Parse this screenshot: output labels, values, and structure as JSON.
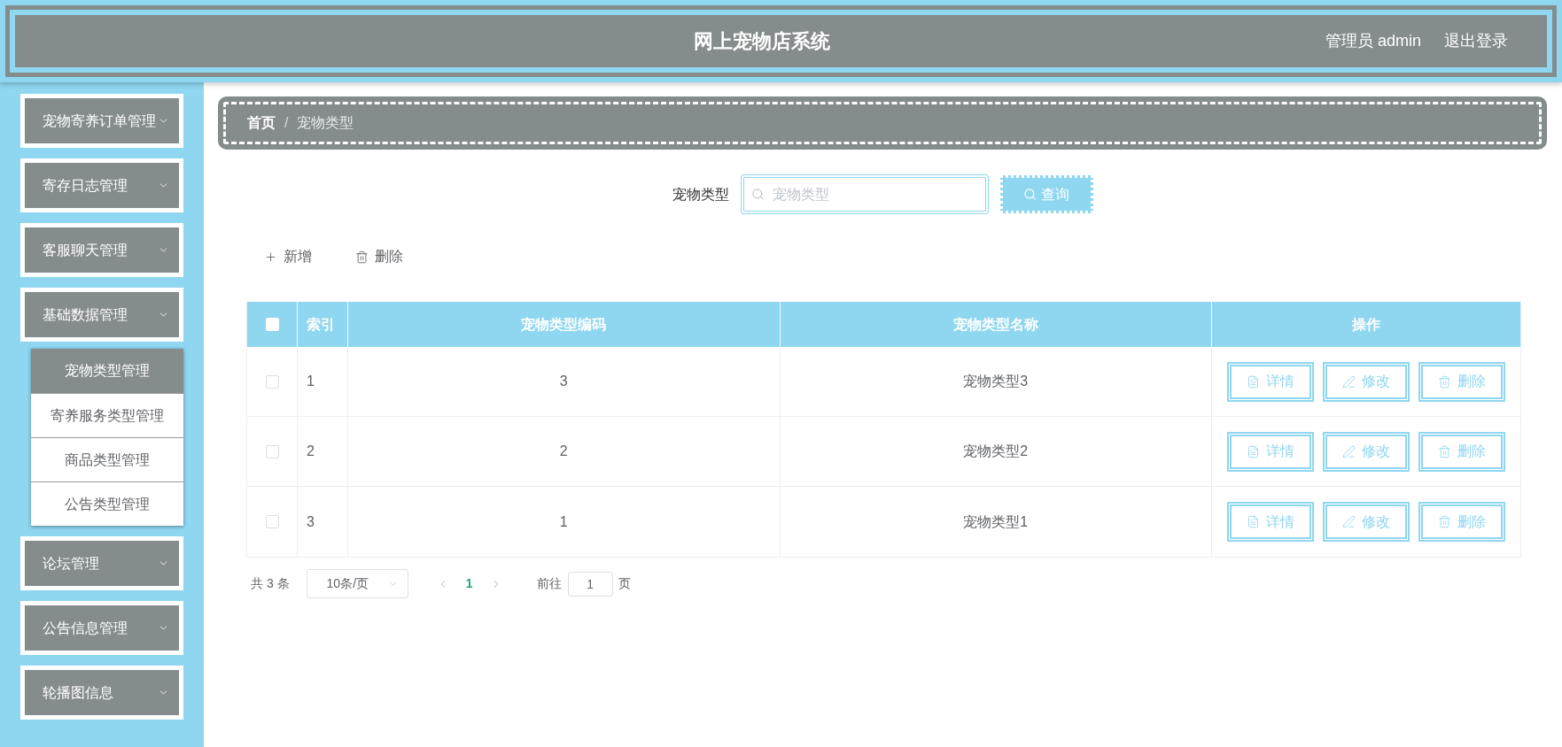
{
  "header": {
    "title": "网上宠物店系统",
    "user": "管理员 admin",
    "logout": "退出登录"
  },
  "sidebar": {
    "items": [
      {
        "label": "宠物寄养订单管理"
      },
      {
        "label": "寄存日志管理"
      },
      {
        "label": "客服聊天管理"
      },
      {
        "label": "基础数据管理",
        "children": [
          {
            "label": "宠物类型管理",
            "selected": true
          },
          {
            "label": "寄养服务类型管理",
            "selected": false
          },
          {
            "label": "商品类型管理",
            "selected": false
          },
          {
            "label": "公告类型管理",
            "selected": false
          }
        ]
      },
      {
        "label": "论坛管理"
      },
      {
        "label": "公告信息管理"
      },
      {
        "label": "轮播图信息"
      }
    ]
  },
  "breadcrumb": {
    "items": [
      {
        "label": "首页",
        "kind": "link"
      },
      {
        "label": "宠物类型",
        "kind": "current"
      }
    ],
    "separator": "/"
  },
  "search": {
    "label": "宠物类型",
    "placeholder": "宠物类型",
    "button": "查询"
  },
  "toolbar": [
    {
      "label": "新增",
      "kind": "add"
    },
    {
      "label": "删除",
      "kind": "delete"
    }
  ],
  "table": {
    "select_all": {
      "checked": false
    },
    "columns": [
      "索引",
      "宠物类型编码",
      "宠物类型名称",
      "操作"
    ],
    "rows": [
      {
        "checked": false,
        "index": "1",
        "code": "3",
        "name": "宠物类型3",
        "actions": [
          {
            "label": "详情",
            "kind": "detail"
          },
          {
            "label": "修改",
            "kind": "edit"
          },
          {
            "label": "删除",
            "kind": "delete"
          }
        ]
      },
      {
        "checked": false,
        "index": "2",
        "code": "2",
        "name": "宠物类型2",
        "actions": [
          {
            "label": "详情",
            "kind": "detail"
          },
          {
            "label": "修改",
            "kind": "edit"
          },
          {
            "label": "删除",
            "kind": "delete"
          }
        ]
      },
      {
        "checked": false,
        "index": "3",
        "code": "1",
        "name": "宠物类型1",
        "actions": [
          {
            "label": "详情",
            "kind": "detail"
          },
          {
            "label": "修改",
            "kind": "edit"
          },
          {
            "label": "删除",
            "kind": "delete"
          }
        ]
      }
    ]
  },
  "pagination": {
    "total": "共 3 条",
    "page_size": "10条/页",
    "pages": [
      {
        "label": "1",
        "selected": true
      }
    ],
    "goto_label": "前往",
    "goto_value": "1",
    "goto_suffix": "页"
  }
}
